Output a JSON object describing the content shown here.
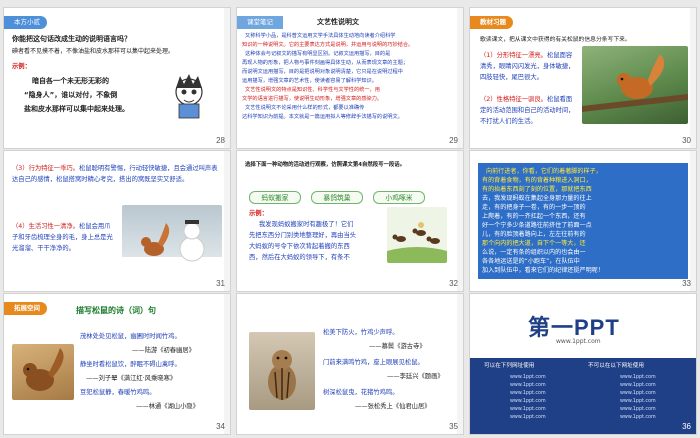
{
  "slides": {
    "s28": {
      "number": "28",
      "tag": "本方小贰",
      "title": "你能把这句话改成生动的说明语言吗？",
      "body1": "碘者看不见摸不着，不像油盐和皮水那样可以集中起来处理。",
      "example_label": "示例：",
      "ex1": "暗自各一个未无形无彩的",
      "ex2": "“隐身人”，谁以对付，不象倒",
      "ex3": "盐和皮水那样可以集中起来处理。"
    },
    "s29": {
      "number": "29",
      "tag": "课堂笔记",
      "heading": "文艺性说明文",
      "lines": [
        "又称科学小品，是科普文运用文学手法具体生动地向读者介绍科学",
        "知识的一种说明文。它的主要表达方式是说明，并运用与说明的巧妙结合。",
        "这种体会与记叙文的描写有明显区别。记叙文运用描写，目的是",
        "再现人物的形象，把人物与事件刻画得具体生动，从而表现文章的主题；",
        "而说明文运用描写，目的是把说明对象说明清楚，它只是在说明过程中",
        "运用描写，增强文章的艺术性，使读者容易了解科学知识。",
        "文艺性说明文的特点是知识性、科学性与文学性的统一，用",
        "文学的语言进行描写，使说明生动形象，增强文章的感染力。",
        "文艺性说明文不论采用什么样的形式，都要以准确传",
        "达科学知识为前提。本文就是一篇运用拟人等修辞手法描写的说明文。"
      ]
    },
    "s30": {
      "number": "30",
      "tag": "教材习题",
      "line1": "歌读课文，把从课文中获得的有关松鼠的信息分条写下来。",
      "p1_label": "（1）分形特征一漂亮。",
      "p1_rest": "松鼠面容清秀，眼睛闪闪发光，身体敏捷，四肢轻快，尾巴很大。",
      "p2_label": "（2）性格特征一驯良。",
      "p2_rest": "松鼠看面定的活动范围和自己的活动时间，不打扰人们的生活。"
    },
    "s31": {
      "number": "31",
      "p3_label": "（3）行为特征一乖巧。",
      "p3_rest": "松鼠聪明有警惕，行动轻快敏捷，且会通过叫声表达自己的感情，松鼠搭窝时精心考究，搭出的窝既坚实又舒适。",
      "p4_label": "（4）生活习性一清净。",
      "p4_rest": "松鼠会用爪子和牙齿梳理全身的毛，身上总是光光溜溜、干干净净的。"
    },
    "s32": {
      "number": "32",
      "tag": "选择下面一种动物的活动进行观察，仿照课文第4自然段写一段话。",
      "options": [
        "蚂蚁搬家",
        "暴鸽筑巢",
        "小鸡啄米"
      ],
      "example_label": "示例：",
      "ex_lines": [
        "我发现蚂蚁搬家时有趣极了！它们",
        "先把东西分门别类地整理好，再由当头",
        "大蚂蚁的号令下依次背起着搬的东西",
        "西，然后在大蚂蚁的领导下，有条不"
      ]
    },
    "s33": {
      "number": "33",
      "lines": [
        "向前行进者，你看，它们的着著脚的样子，",
        "有的背着食物，有的背着种粮进入洞口，",
        "有的抬着东西刻了刻的位置，那就把东西",
        "去，我发现蚂蚁在集起全身那力量的往上",
        "走，有的把身子一卷，有的一步一顶的",
        "上爬着，有的一齐扛起一个东西，还有",
        "好一个宁多少条道路往前挤住了前面一点",
        "儿，有的脸顶着路向上，左左往前有的",
        "那个向内的把大道，自下个一等大，还",
        "么说，一定有条的组织以内的也会由一",
        "各各地运送是的“小跑车”，在队伍中",
        "加入到队伍中，看来它们的纪律还挺严明呢！"
      ]
    },
    "s34": {
      "number": "34",
      "tag": "拓展空间",
      "title": "描写松鼠的诗（词）句",
      "poems": [
        {
          "line": "茂林处处见松鼠，幽圃时时闻竹鸡。",
          "author": "——陆游《初春幽居》"
        },
        {
          "line": "静坐时看松鼠饮，醉眠不碍山禽呼。",
          "author": "——刘子翚《满江红·风乘晓寒》"
        },
        {
          "line": "豆犯松鼠静，春暖竹鸡鸣。",
          "author": "——林通《湖山小隐》"
        }
      ]
    },
    "s35": {
      "number": "35",
      "poems": [
        {
          "line": "松美下防火，竹鸡少声呼。",
          "author": "——慕鬓《游古寺》"
        },
        {
          "line": "门前来满鸣竹鸡，座上眼展见松鼠。",
          "author": "——李廷兴《题画》"
        },
        {
          "line": "树深松鼠曳，花猪竹鸡鸣。",
          "author": "——张松秀上《仙君山居》"
        }
      ]
    },
    "s36": {
      "number": "36",
      "logo": "第一PPT",
      "logo_sub": "www.1ppt.com",
      "left_title": "可以在下列网址使用",
      "right_title": "不可以在以下网址使用",
      "left_links": [
        "www.1ppt.com",
        "www.1ppt.com",
        "www.1ppt.com",
        "www.1ppt.com",
        "www.1ppt.com",
        "www.1ppt.com"
      ],
      "right_links": [
        "www.1ppt.com",
        "www.1ppt.com",
        "www.1ppt.com",
        "www.1ppt.com",
        "www.1ppt.com",
        "www.1ppt.com"
      ]
    }
  },
  "colors": {
    "blue_tag": "#4d8fd8",
    "orange_tag": "#e8891e",
    "red_text": "#d21a1a",
    "blue_text": "#1e3fb8",
    "slide33_bg": "#2f6ec6",
    "slide36_bg": "#1f3f86"
  }
}
